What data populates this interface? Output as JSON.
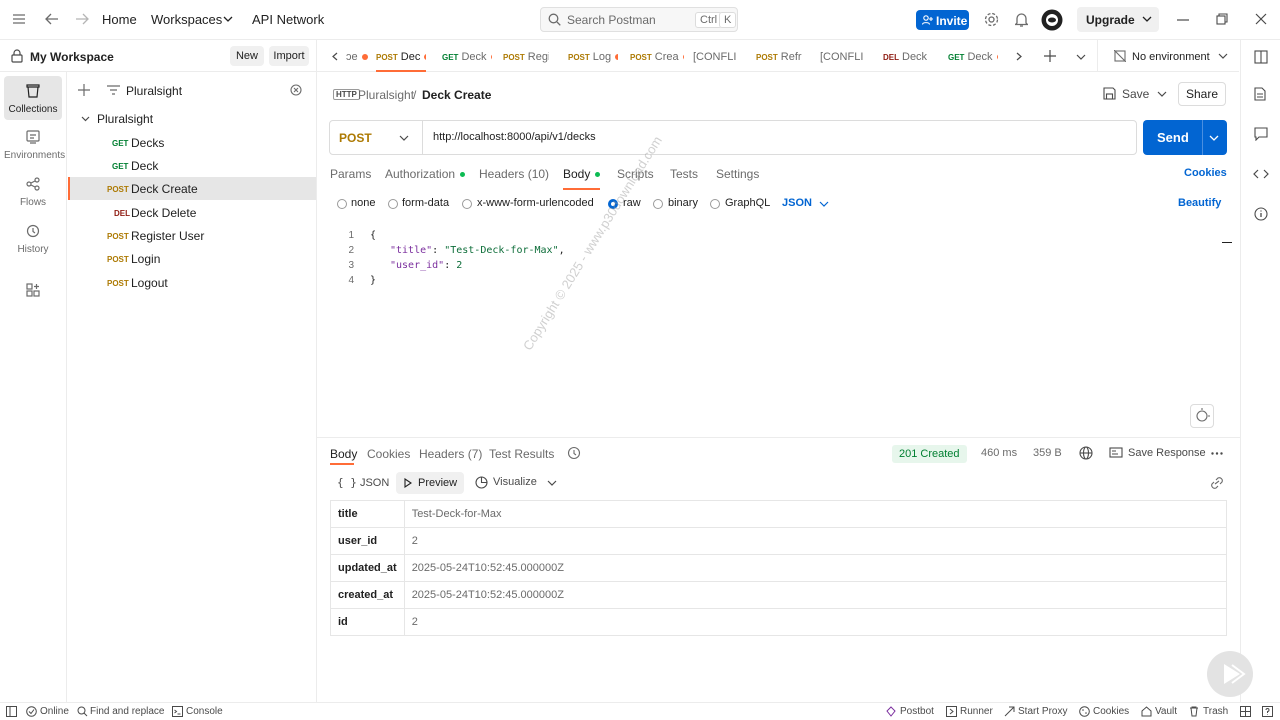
{
  "topbar": {
    "home": "Home",
    "workspaces": "Workspaces",
    "api_network": "API Network",
    "search_placeholder": "Search Postman",
    "shortcut_ctrl": "Ctrl",
    "shortcut_k": "K",
    "invite": "Invite",
    "upgrade": "Upgrade"
  },
  "workspace": {
    "name": "My Workspace",
    "new_label": "New",
    "import_label": "Import"
  },
  "rail": [
    {
      "label": "Collections",
      "icon": "collections-icon"
    },
    {
      "label": "Environments",
      "icon": "environments-icon"
    },
    {
      "label": "Flows",
      "icon": "flows-icon"
    },
    {
      "label": "History",
      "icon": "history-icon"
    }
  ],
  "tree": {
    "filter_value": "Pluralsight",
    "collection": "Pluralsight",
    "items": [
      {
        "method": "GET",
        "name": "Decks"
      },
      {
        "method": "GET",
        "name": "Deck"
      },
      {
        "method": "POST",
        "name": "Deck Create"
      },
      {
        "method": "DEL",
        "name": "Deck Delete"
      },
      {
        "method": "POST",
        "name": "Register User"
      },
      {
        "method": "POST",
        "name": "Login"
      },
      {
        "method": "POST",
        "name": "Logout"
      }
    ]
  },
  "tabs": [
    {
      "method": "",
      "name": "ɔe"
    },
    {
      "method": "POST",
      "name": "Dec"
    },
    {
      "method": "GET",
      "name": "Deck"
    },
    {
      "method": "POST",
      "name": "Regi"
    },
    {
      "method": "POST",
      "name": "Log"
    },
    {
      "method": "POST",
      "name": "Crea"
    },
    {
      "method": "",
      "name": "[CONFLIC"
    },
    {
      "method": "POST",
      "name": "Refr"
    },
    {
      "method": "",
      "name": "[CONFLIC"
    },
    {
      "method": "DEL",
      "name": "Deck"
    },
    {
      "method": "GET",
      "name": "Deck"
    }
  ],
  "environment": "No environment",
  "request": {
    "http_badge": "HTTP",
    "breadcrumb_collection": "Pluralsight",
    "breadcrumb_separator": "/",
    "breadcrumb_request": "Deck Create",
    "save_label": "Save",
    "share_label": "Share",
    "method": "POST",
    "url": "http://localhost:8000/api/v1/decks",
    "send_label": "Send",
    "tabs": [
      "Params",
      "Authorization",
      "Headers (10)",
      "Body",
      "Scripts",
      "Tests",
      "Settings"
    ],
    "cookies_label": "Cookies",
    "body_types": [
      "none",
      "form-data",
      "x-www-form-urlencoded",
      "raw",
      "binary",
      "GraphQL"
    ],
    "body_format": "JSON",
    "beautify_label": "Beautify",
    "code_lines": [
      "1",
      "2",
      "3",
      "4"
    ],
    "code": {
      "open": "{",
      "title_key": "\"title\"",
      "title_value": "\"Test-Deck-for-Max\"",
      "user_key": "\"user_id\"",
      "user_value": "2",
      "close": "}"
    }
  },
  "response": {
    "tabs": [
      "Body",
      "Cookies",
      "Headers (7)",
      "Test Results"
    ],
    "status": "201 Created",
    "time": "460 ms",
    "size": "359 B",
    "save_response": "Save Response",
    "view_json": "JSON",
    "view_preview": "Preview",
    "view_visualize": "Visualize",
    "rows": [
      {
        "key": "title",
        "value": "Test-Deck-for-Max"
      },
      {
        "key": "user_id",
        "value": "2"
      },
      {
        "key": "updated_at",
        "value": "2025-05-24T10:52:45.000000Z"
      },
      {
        "key": "created_at",
        "value": "2025-05-24T10:52:45.000000Z"
      },
      {
        "key": "id",
        "value": "2"
      }
    ]
  },
  "statusbar": {
    "online": "Online",
    "find_replace": "Find and replace",
    "console": "Console",
    "postbot": "Postbot",
    "runner": "Runner",
    "start_proxy": "Start Proxy",
    "cookies": "Cookies",
    "vault": "Vault",
    "trash": "Trash"
  },
  "watermark": "Copyright © 2025 - www.p30download.com",
  "colors": {
    "accent": "#ff6c37",
    "primary": "#0265d2",
    "get": "#007f31",
    "post": "#ad7a03",
    "delete": "#8e1a10"
  }
}
